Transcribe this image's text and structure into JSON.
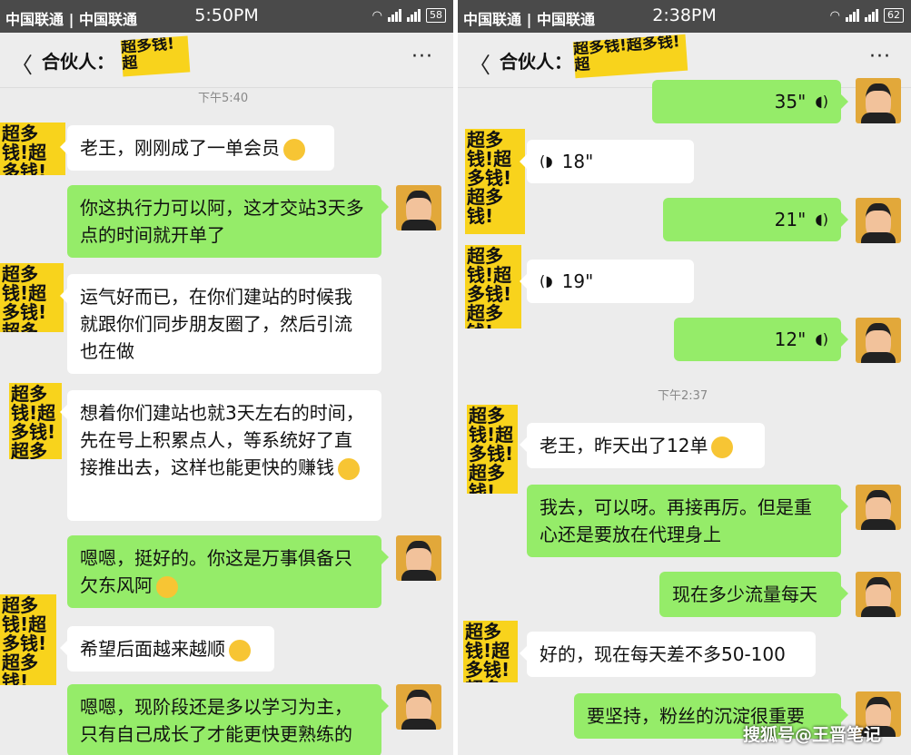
{
  "panels": [
    {
      "status": {
        "carriers": "中国联通 | 中国联通",
        "time": "5:50PM",
        "battery": "58"
      },
      "nav": {
        "back": "〈",
        "title": "合伙人：",
        "logo": "超多钱!超",
        "more": "···"
      },
      "timestamp": "下午5:40",
      "messages": [
        {
          "text": "老王，刚刚成了一单会员"
        },
        {
          "text": "你这执行力可以阿，这才交站3天多点的时间就开单了"
        },
        {
          "text": "运气好而已，在你们建站的时候我就跟你们同步朋友圈了，然后引流也在做"
        },
        {
          "text": "想着你们建站也就3天左右的时间，先在号上积累点人，等系统好了直接推出去，这样也能更快的赚钱"
        },
        {
          "text": "嗯嗯，挺好的。你这是万事俱备只欠东风阿"
        },
        {
          "text": "希望后面越来越顺"
        },
        {
          "text": "嗯嗯，现阶段还是多以学习为主，只有自己成长了才能更快更熟练的"
        }
      ]
    },
    {
      "status": {
        "carriers": "中国联通 | 中国联通",
        "time": "2:38PM",
        "battery": "62"
      },
      "nav": {
        "back": "〈",
        "title": "合伙人：",
        "logo": "超多钱!超多钱!超",
        "more": "···"
      },
      "timestamp": "下午2:37",
      "voices": [
        {
          "duration": "35\""
        },
        {
          "duration": "18\""
        },
        {
          "duration": "21\""
        },
        {
          "duration": "19\""
        },
        {
          "duration": "12\""
        }
      ],
      "messages": [
        {
          "text": "老王，昨天出了12单"
        },
        {
          "text": "我去，可以呀。再接再厉。但是重心还是要放在代理身上"
        },
        {
          "text": "现在多少流量每天"
        },
        {
          "text": "好的，现在每天差不多50-100"
        },
        {
          "text": "要坚持，粉丝的沉淀很重要"
        }
      ]
    }
  ],
  "avatar_logo_text": "超多钱!超多钱!超多钱!",
  "watermark": "搜狐号@王晋笔记",
  "colors": {
    "outgoing": "#95ec69",
    "incoming": "#ffffff",
    "logo_yellow": "#f8d31c"
  }
}
